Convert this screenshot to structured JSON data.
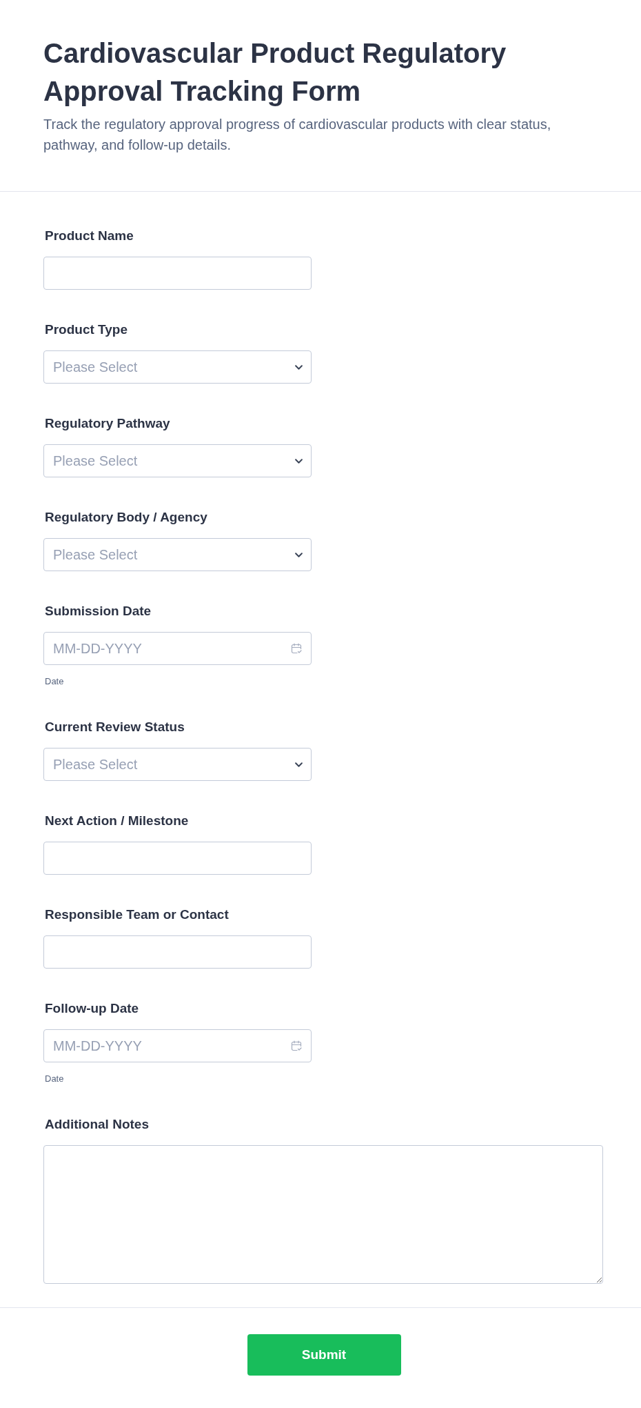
{
  "header": {
    "title": "Cardiovascular Product Regulatory Approval Tracking Form",
    "subtitle": "Track the regulatory approval progress of cardiovascular products with clear status, pathway, and follow-up details."
  },
  "fields": [
    {
      "label": "Product Name",
      "kind": "text"
    },
    {
      "label": "Product Type",
      "kind": "select",
      "placeholder": "Please Select"
    },
    {
      "label": "Regulatory Pathway",
      "kind": "select",
      "placeholder": "Please Select"
    },
    {
      "label": "Regulatory Body / Agency",
      "kind": "select",
      "placeholder": "Please Select"
    },
    {
      "label": "Submission Date",
      "kind": "date",
      "placeholder": "MM-DD-YYYY",
      "sublabel": "Date"
    },
    {
      "label": "Current Review Status",
      "kind": "select",
      "placeholder": "Please Select"
    },
    {
      "label": "Next Action / Milestone",
      "kind": "text"
    },
    {
      "label": "Responsible Team or Contact",
      "kind": "text"
    },
    {
      "label": "Follow-up Date",
      "kind": "date",
      "placeholder": "MM-DD-YYYY",
      "sublabel": "Date"
    },
    {
      "label": "Additional Notes",
      "kind": "textarea"
    }
  ],
  "submit_button": "Submit"
}
